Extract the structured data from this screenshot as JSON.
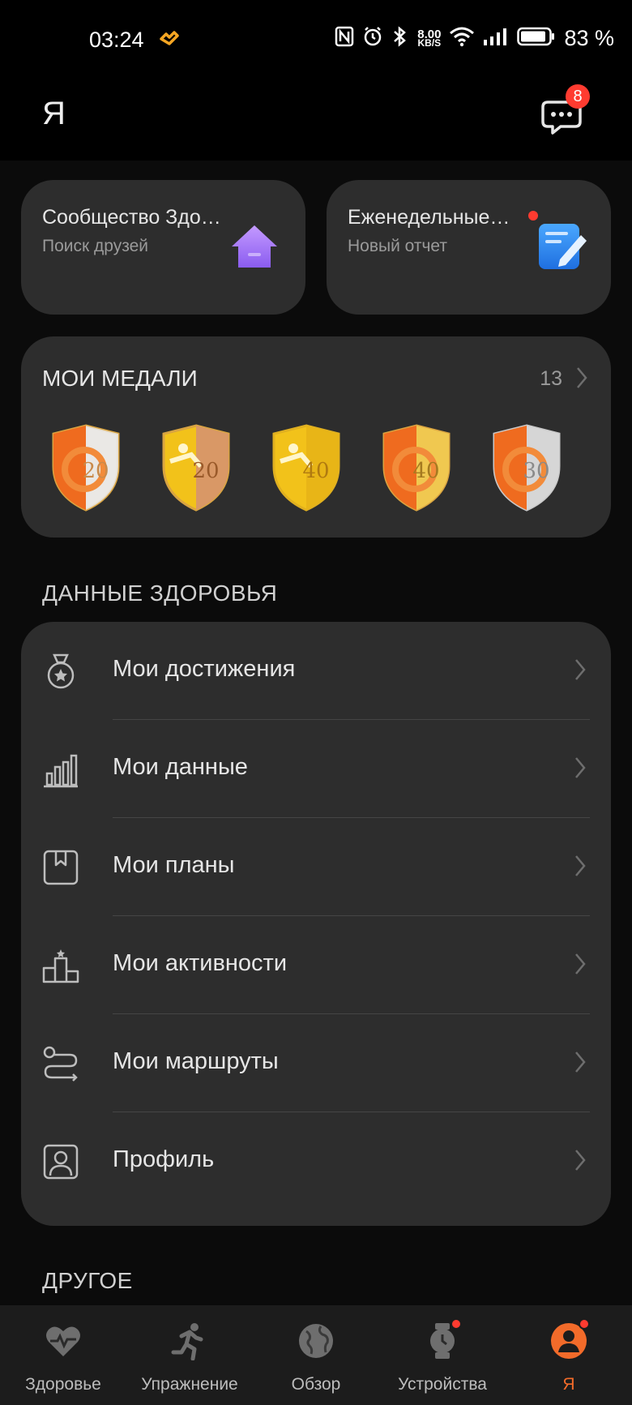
{
  "status_bar": {
    "time": "03:24",
    "net_speed_value": "8.00",
    "net_speed_unit": "KB/S",
    "battery": "83 %"
  },
  "header": {
    "title": "Я",
    "messages_badge": "8"
  },
  "quick_cards": [
    {
      "title": "Сообщество Здоровья",
      "subtitle": "Поиск друзей",
      "icon": "home-icon"
    },
    {
      "title": "Еженедельные отчеты",
      "subtitle": "Новый отчет",
      "icon": "notepad-edit-icon",
      "has_dot": true
    }
  ],
  "medals": {
    "title": "МОИ МЕДАЛИ",
    "count": "13",
    "items": [
      {
        "label": "20",
        "style": "orange-silver"
      },
      {
        "label": "20",
        "style": "gold-bronze"
      },
      {
        "label": "40",
        "style": "gold"
      },
      {
        "label": "40",
        "style": "orange-gold"
      },
      {
        "label": "30",
        "style": "orange-silver"
      }
    ]
  },
  "health_section": {
    "title": "ДАННЫЕ ЗДОРОВЬЯ",
    "items": [
      {
        "label": "Мои достижения",
        "icon": "medal-icon"
      },
      {
        "label": "Мои данные",
        "icon": "bar-chart-icon"
      },
      {
        "label": "Мои планы",
        "icon": "bookmark-plan-icon"
      },
      {
        "label": "Мои активности",
        "icon": "podium-icon"
      },
      {
        "label": "Мои маршруты",
        "icon": "route-icon"
      },
      {
        "label": "Профиль",
        "icon": "profile-icon"
      }
    ]
  },
  "other_section": {
    "title": "ДРУГОЕ"
  },
  "bottom_nav": [
    {
      "label": "Здоровье",
      "icon": "heart-pulse-icon",
      "active": false
    },
    {
      "label": "Упражнение",
      "icon": "running-icon",
      "active": false
    },
    {
      "label": "Обзор",
      "icon": "globe-icon",
      "active": false
    },
    {
      "label": "Устройства",
      "icon": "watch-icon",
      "active": false,
      "dot": true
    },
    {
      "label": "Я",
      "icon": "user-icon",
      "active": true,
      "dot": true
    }
  ],
  "colors": {
    "accent": "#f26b2a",
    "badge": "#ff3b30",
    "card": "#2d2d2d",
    "background": "#000000"
  }
}
